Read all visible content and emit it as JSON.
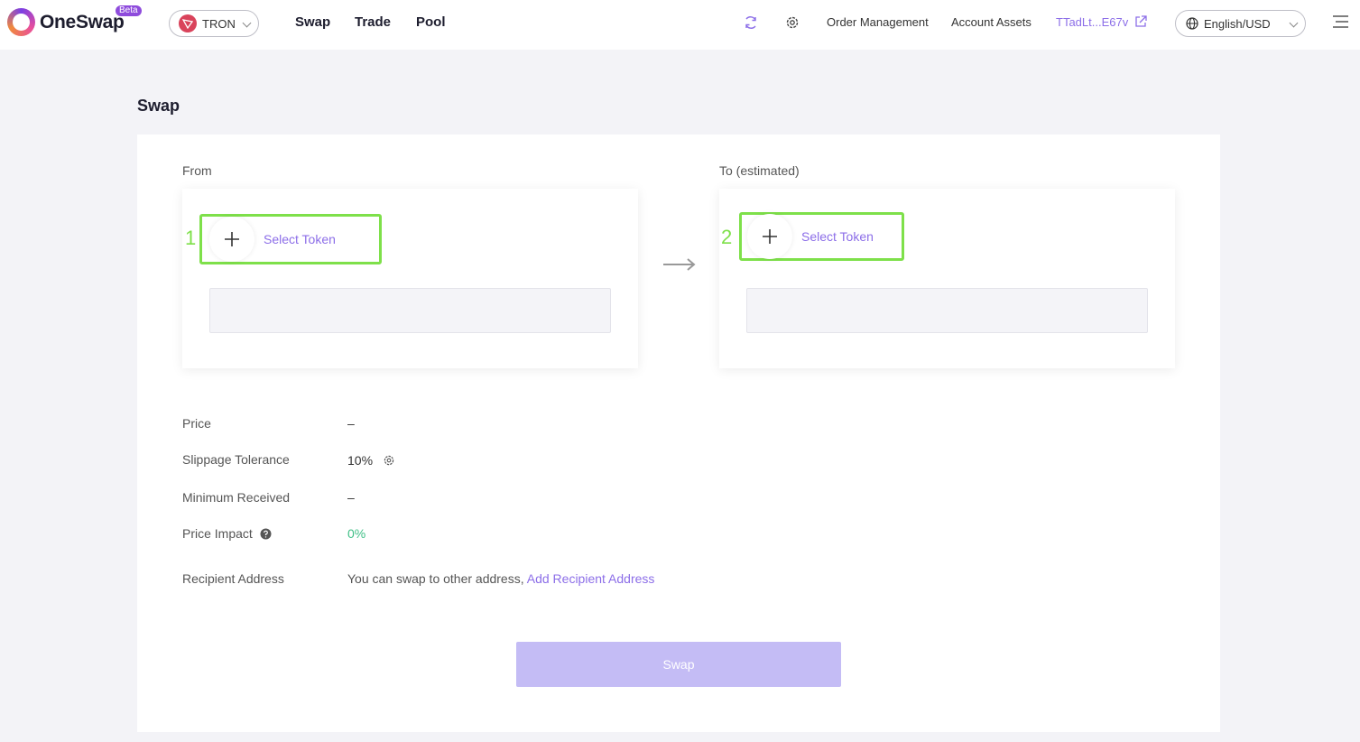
{
  "header": {
    "logo_text": "OneSwap",
    "beta_badge": "Beta",
    "chain": "TRON",
    "nav": [
      "Swap",
      "Trade",
      "Pool"
    ],
    "order_management": "Order Management",
    "account_assets": "Account Assets",
    "address": "TTadLt...E67v",
    "language": "English/USD"
  },
  "page": {
    "title": "Swap"
  },
  "from": {
    "label": "From",
    "select_token": "Select Token",
    "step": "1"
  },
  "to": {
    "label": "To (estimated)",
    "select_token": "Select Token",
    "step": "2"
  },
  "details": {
    "price_label": "Price",
    "price_value": "–",
    "slippage_label": "Slippage Tolerance",
    "slippage_value": "10%",
    "min_received_label": "Minimum Received",
    "min_received_value": "–",
    "price_impact_label": "Price Impact",
    "price_impact_value": "0%",
    "recipient_label": "Recipient Address",
    "recipient_text": "You can swap to other address,",
    "recipient_link": "Add Recipient Address"
  },
  "swap_button": "Swap",
  "colors": {
    "accent": "#8c6ee8",
    "highlight": "#7ee04a",
    "positive": "#3fbf86",
    "button_disabled": "#c4bcf5"
  }
}
